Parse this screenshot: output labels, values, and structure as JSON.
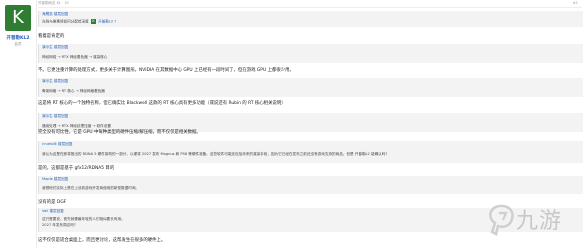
{
  "user": {
    "avatar_letter": "K",
    "name": "开普勒KL2",
    "sub": "会员",
    "avatar_color": "#2e7d32"
  },
  "topbar": {
    "left": "开普勒网友 KL · 19",
    "right": "#1"
  },
  "posts": [
    {
      "type": "quote",
      "name": "海鹰张 楼层回复",
      "lines": [
        "光线与像素将如何分配给深度",
        "开普勒L2 ?"
      ]
    },
    {
      "type": "reply",
      "text": "看着是肯定的"
    },
    {
      "type": "quote",
      "name": "演示生 楼层回复",
      "lines": [
        "神经网络 → RTX 神经着色器 → 渲染核心"
      ]
    },
    {
      "type": "reply",
      "text": "不。它更注重计算的处理方式，更多关于计算图形。NVIDIA 在其数据中心 GPU 上已经有一段时间了，但在游戏 GPU 上都很少用。"
    },
    {
      "type": "quote",
      "name": "演示生 楼层回复",
      "lines": [
        "骨架网格 → RT 核心 → 神经网格着色器"
      ]
    },
    {
      "type": "reply",
      "text": "这是将 RT 核心的一个独特名称，但它确实比 Blackwell 这款的 RT 核心具有更多功能（或说还有 Rubin 的 RT 核心相关说明）"
    },
    {
      "type": "quote",
      "name": "演示生 楼层回复",
      "lines": [
        "通用处理 → RTX 神经纹理压缩 → 软件设置"
      ]
    },
    {
      "type": "reply",
      "text": "完全没有可比性，它是 GPU 中每种类型的硬件压缩/解压缩，而不仅仅是相关数据。"
    },
    {
      "type": "quote",
      "name": "cruelsilk 楼层回复",
      "lines": [
        "我认为这是在即将推出的 RDNA 5 硬件架构的一部分，以便将 2027 发布 Magnus 和 PS6 等硬件准备。这些软件可能还包括未来的渲染手段，因为它已经在发布之前还没有游戏支持的商品。但是 开普勒L2 能确认吗?"
      ]
    },
    {
      "type": "reply",
      "text": "是的，这都是基于 gfx12/RDNA5 目的"
    },
    {
      "type": "quote",
      "name": "Maple 楼层回复",
      "lines": [
        "我想他们实际上是在上谈到游戏开发商使用的新型数据时间。"
      ]
    },
    {
      "type": "reply",
      "text": "没有的是 DGF"
    },
    {
      "type": "quote",
      "name": "Vall 楼层回复",
      "lines": [
        "这只是要说，首先就像最年轻的人们相似要长有用。",
        "2027 年发布周边吗?"
      ]
    },
    {
      "type": "reply",
      "text": "这不仅仅是适合桌面上，而且更讨论，这帮发生在很多的硬件上。"
    }
  ],
  "watermark": {
    "text": "九游"
  }
}
